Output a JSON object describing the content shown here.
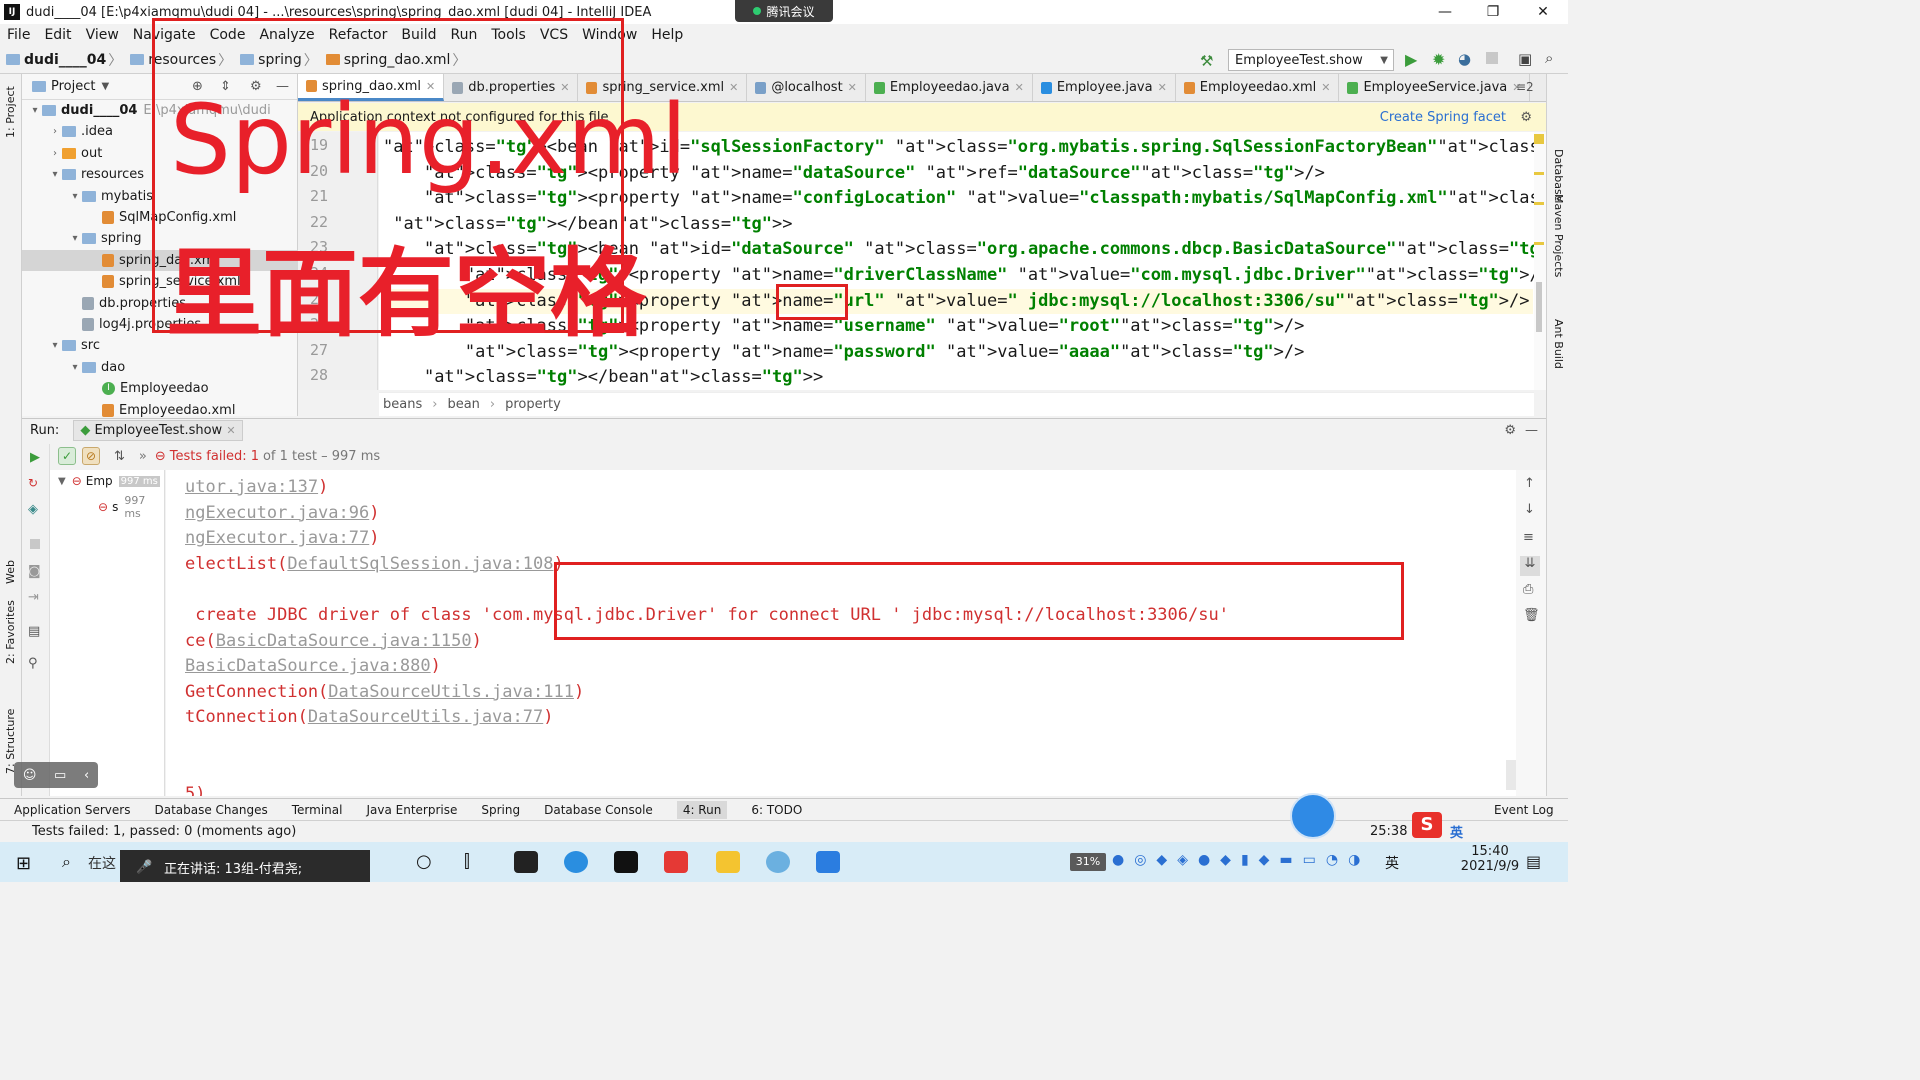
{
  "window": {
    "title": "dudi____04 [E:\\p4xiamqmu\\dudi          04] - ...\\resources\\spring\\spring_dao.xml [dudi          04] - IntelliJ IDEA",
    "meeting_label": "腾讯会议",
    "controls": [
      "—",
      "❐",
      "✕"
    ]
  },
  "menu": [
    "File",
    "Edit",
    "View",
    "Navigate",
    "Code",
    "Analyze",
    "Refactor",
    "Build",
    "Run",
    "Tools",
    "VCS",
    "Window",
    "Help"
  ],
  "nav": {
    "crumbs": [
      "dudi____04",
      "resources",
      "spring",
      "spring_dao.xml"
    ],
    "run_config": "EmployeeTest.show"
  },
  "project": {
    "header": "Project",
    "tree": [
      {
        "label": "dudi____04",
        "extra": "E:\\p4xiamqmu\\dudi",
        "depth": 0,
        "icon": "folder",
        "expanded": true
      },
      {
        "label": ".idea",
        "depth": 1,
        "icon": "folder",
        "expanded": false
      },
      {
        "label": "out",
        "depth": 1,
        "icon": "folder-orange",
        "expanded": false
      },
      {
        "label": "resources",
        "depth": 1,
        "icon": "folder",
        "expanded": true
      },
      {
        "label": "mybatis",
        "depth": 2,
        "icon": "folder",
        "expanded": true
      },
      {
        "label": "SqlMapConfig.xml",
        "depth": 3,
        "icon": "xml"
      },
      {
        "label": "spring",
        "depth": 2,
        "icon": "folder",
        "expanded": true
      },
      {
        "label": "spring_dao.xml",
        "depth": 3,
        "icon": "xml",
        "selected": true
      },
      {
        "label": "spring_service.xml",
        "depth": 3,
        "icon": "xml"
      },
      {
        "label": "db.properties",
        "depth": 2,
        "icon": "props"
      },
      {
        "label": "log4j.properties",
        "depth": 2,
        "icon": "props"
      },
      {
        "label": "src",
        "depth": 1,
        "icon": "folder",
        "expanded": true
      },
      {
        "label": "dao",
        "depth": 2,
        "icon": "folder",
        "expanded": true
      },
      {
        "label": "Employeedao",
        "depth": 3,
        "icon": "interface"
      },
      {
        "label": "Employeedao.xml",
        "depth": 3,
        "icon": "xml"
      }
    ]
  },
  "editor": {
    "tabs": [
      {
        "label": "spring_dao.xml",
        "active": true
      },
      {
        "label": "db.properties"
      },
      {
        "label": "spring_service.xml"
      },
      {
        "label": "@localhost"
      },
      {
        "label": "Employeedao.java"
      },
      {
        "label": "Employee.java"
      },
      {
        "label": "Employeedao.xml"
      },
      {
        "label": "EmployeeService.java"
      }
    ],
    "tab_overflow": "≡2",
    "banner": "Application context not configured for this file",
    "banner_link": "Create Spring facet",
    "line_numbers": [
      "19",
      "20",
      "21",
      "22",
      "23",
      "24",
      "25",
      "26",
      "27",
      "28"
    ],
    "lines": [
      "<bean id=\"sqlSessionFactory\" class=\"org.mybatis.spring.SqlSessionFactoryBean\">",
      "    <property name=\"dataSource\" ref=\"dataSource\"/>",
      "    <property name=\"configLocation\" value=\"classpath:mybatis/SqlMapConfig.xml\"/>",
      " </bean>",
      "    <bean id=\"dataSource\" class=\"org.apache.commons.dbcp.BasicDataSource\">",
      "        <property name=\"driverClassName\" value=\"com.mysql.jdbc.Driver\"/>",
      "        <property name=\"url\" value=\" jdbc:mysql://localhost:3306/su\"/>",
      "        <property name=\"username\" value=\"root\"/>",
      "        <property name=\"password\" value=\"aaaa\"/>",
      "    </bean>"
    ],
    "breadcrumb": [
      "beans",
      "bean",
      "property"
    ]
  },
  "run": {
    "label": "Run:",
    "tab": "EmployeeTest.show",
    "status": "Tests failed:",
    "status_count": "1",
    "status_rest": "of 1 test – 997 ms",
    "tree": [
      {
        "label": "Emp",
        "time": "997 ms"
      },
      {
        "label": "s",
        "time": "997 ms"
      }
    ],
    "console": [
      {
        "pre": "",
        "link": "utor.java:137",
        "post": ")"
      },
      {
        "pre": "",
        "link": "ngExecutor.java:96",
        "post": ")"
      },
      {
        "pre": "",
        "link": "ngExecutor.java:77",
        "post": ")"
      },
      {
        "pre": "electList(",
        "link": "DefaultSqlSession.java:108",
        "post": ")"
      },
      {
        "pre": "",
        "link": "",
        "post": ""
      },
      {
        "pre": " create JDBC driver of class 'com.mysql.jdbc.Driver' for connect URL ' jdbc:mysql://localhost:3306/su'",
        "link": "",
        "post": ""
      },
      {
        "pre": "ce(",
        "link": "BasicDataSource.java:1150",
        "post": ")"
      },
      {
        "pre": "",
        "link": "BasicDataSource.java:880",
        "post": ")"
      },
      {
        "pre": "GetConnection(",
        "link": "DataSourceUtils.java:111",
        "post": ")"
      },
      {
        "pre": "tConnection(",
        "link": "DataSourceUtils.java:77",
        "post": ")"
      },
      {
        "pre": "",
        "link": "",
        "post": ""
      },
      {
        "pre": "",
        "link": "",
        "post": ""
      },
      {
        "pre": "5)",
        "link": "",
        "post": ""
      }
    ]
  },
  "toolwindows": [
    "Application Servers",
    "Database Changes",
    "Terminal",
    "Java Enterprise",
    "Spring",
    "Database Console",
    "4: Run",
    "6: TODO"
  ],
  "event_log": "Event Log",
  "left_strip": [
    "1: Project",
    "Web",
    "2: Favorites",
    "7: Structure"
  ],
  "right_strip": [
    "Database",
    "Maven Projects",
    "Ant Build"
  ],
  "statusbar": {
    "text": "Tests failed: 1, passed: 0 (moments ago)",
    "time": "25:38",
    "ime": "英"
  },
  "taskbar": {
    "search_placeholder": "在这",
    "speaking": "正在讲话: 13组-付君尧;",
    "battery": "31%",
    "ime": "英",
    "clock_time": "15:40",
    "clock_date": "2021/9/9"
  },
  "annotations": {
    "big_title": "Spring.xml",
    "note": "里面有空格",
    "color": "#e8202a"
  }
}
